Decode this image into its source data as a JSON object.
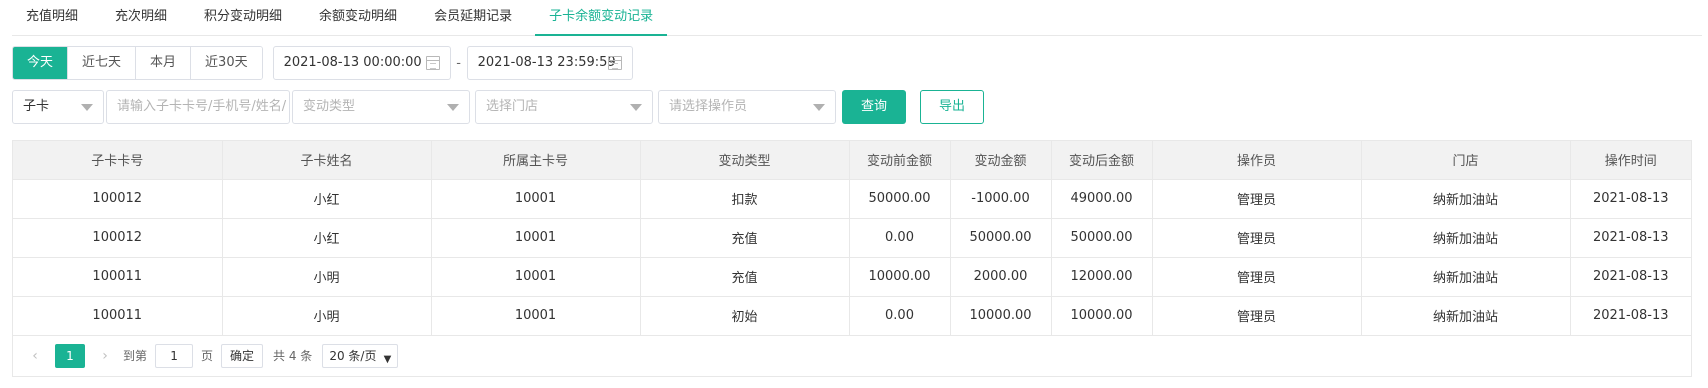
{
  "tabs": [
    {
      "label": "充值明细",
      "active": false
    },
    {
      "label": "充次明细",
      "active": false
    },
    {
      "label": "积分变动明细",
      "active": false
    },
    {
      "label": "余额变动明细",
      "active": false
    },
    {
      "label": "会员延期记录",
      "active": false
    },
    {
      "label": "子卡余额变动记录",
      "active": true
    }
  ],
  "quick_range": {
    "today": "今天",
    "seven_days": "近七天",
    "this_month": "本月",
    "thirty_days": "近30天",
    "selected": "今天"
  },
  "date_range": {
    "start": "2021-08-13 00:00:00",
    "separator": "-",
    "end": "2021-08-13 23:59:59"
  },
  "filters": {
    "card_type": "子卡",
    "keyword_placeholder": "请输入子卡卡号/手机号/姓名/",
    "change_type_placeholder": "变动类型",
    "store_placeholder": "选择门店",
    "operator_placeholder": "请选择操作员",
    "query_label": "查询",
    "export_label": "导出"
  },
  "table": {
    "columns": [
      "子卡卡号",
      "子卡姓名",
      "所属主卡号",
      "变动类型",
      "变动前金额",
      "变动金额",
      "变动后金额",
      "操作员",
      "门店",
      "操作时间"
    ],
    "rows": [
      [
        "100012",
        "小红",
        "10001",
        "扣款",
        "50000.00",
        "-1000.00",
        "49000.00",
        "管理员",
        "纳新加油站",
        "2021-08-13"
      ],
      [
        "100012",
        "小红",
        "10001",
        "充值",
        "0.00",
        "50000.00",
        "50000.00",
        "管理员",
        "纳新加油站",
        "2021-08-13"
      ],
      [
        "100011",
        "小明",
        "10001",
        "充值",
        "10000.00",
        "2000.00",
        "12000.00",
        "管理员",
        "纳新加油站",
        "2021-08-13"
      ],
      [
        "100011",
        "小明",
        "10001",
        "初始",
        "0.00",
        "10000.00",
        "10000.00",
        "管理员",
        "纳新加油站",
        "2021-08-13"
      ]
    ]
  },
  "pagination": {
    "prev": "‹",
    "current_page": "1",
    "next": "›",
    "goto_label": "到第",
    "goto_value": "1",
    "page_unit": "页",
    "confirm": "确定",
    "total": "共 4 条",
    "page_size": "20 条/页",
    "page_size_arrow": "▼"
  },
  "colors": {
    "accent": "#1ab394",
    "header_bg": "#f2f2f2",
    "border": "#e8e8e8"
  }
}
